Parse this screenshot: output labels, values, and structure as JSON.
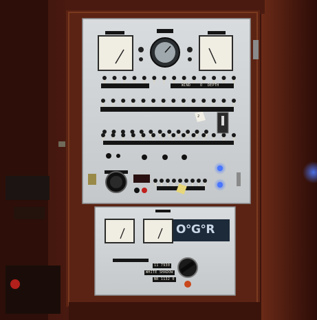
{
  "photo": {
    "panel_labels": {
      "wind": "WIND",
      "depth": "DEPTH",
      "zero": "O",
      "tag_number": "2"
    },
    "brand_plate": "O°G°R",
    "plate_lines": [
      "11 7930",
      "WHITE SHADOW",
      "NR 1132 0"
    ],
    "indicator_colors": {
      "blue_led": "#3a6bff",
      "red_button": "#c0201c",
      "tag_yellow": "#e8d77a"
    }
  }
}
